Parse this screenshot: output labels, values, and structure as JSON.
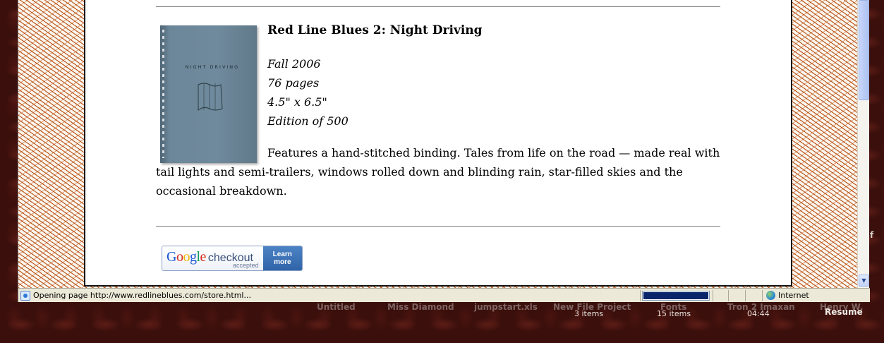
{
  "product": {
    "title": "Red Line Blues 2: Night Driving",
    "meta": [
      "Fall 2006",
      "76 pages",
      "4.5\" x 6.5\"",
      "Edition of 500"
    ],
    "description": "Features a hand-stitched binding. Tales from life on the road — made real with tail lights and semi-trailers, windows rolled down and blinding rain, star-filled skies and the occasional breakdown.",
    "cover_title": "NIGHT DRIVING"
  },
  "checkout_badge": {
    "google": "Google",
    "checkout": "checkout",
    "accepted": "accepted",
    "learn": "Learn",
    "more": "more"
  },
  "statusbar": {
    "text": "Opening page http://www.redlineblues.com/store.html...",
    "zone": "Internet",
    "progress": 1.0
  },
  "desktop": {
    "labels": [
      "Untitled",
      "Miss Diamond",
      "jumpstart.xls",
      "New File Project",
      "Fonts",
      "Tron 2 Imaxan",
      "Henry W."
    ],
    "subs": [
      "3 items",
      "15 items",
      "04:44"
    ],
    "resume": "Resume",
    "edge_letter": "f"
  },
  "colors": {
    "pattern": "#b84a0a",
    "progress_fill": "#0a246a",
    "checkout_blue": "#2f64a8"
  }
}
